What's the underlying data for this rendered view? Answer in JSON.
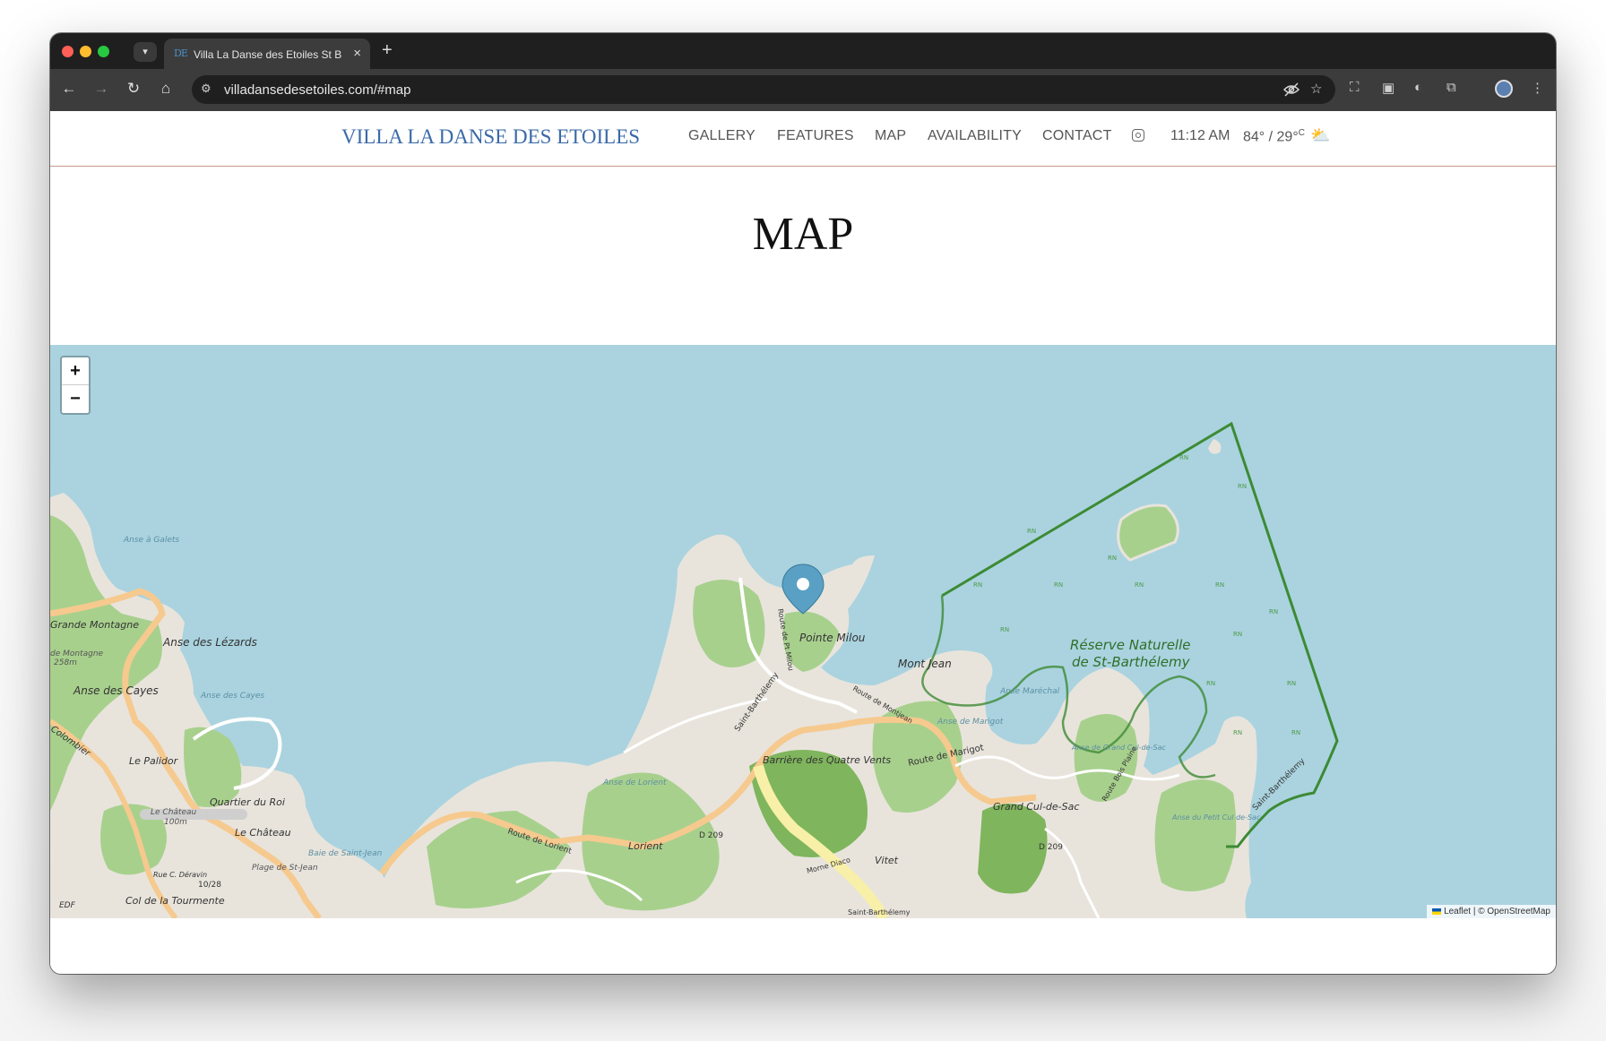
{
  "browser": {
    "tab": {
      "favicon": "DE",
      "title": "Villa La Danse des Etoiles St B",
      "close_glyph": "×"
    },
    "new_tab_glyph": "+",
    "url": "villadansedesetoiles.com/#map",
    "icons": [
      "chevron-down-icon",
      "back-icon",
      "forward-icon",
      "reload-icon",
      "home-icon",
      "site-info-icon",
      "eye-off-icon",
      "star-icon",
      "screen-icon",
      "camera-icon",
      "contrast-icon",
      "puzzle-icon",
      "avatar",
      "more-icon"
    ]
  },
  "site": {
    "brand": "VILLA LA DANSE DES ETOILES",
    "nav": {
      "gallery": "GALLERY",
      "features": "FEATURES",
      "map": "MAP",
      "availability": "AVAILABILITY",
      "contact": "CONTACT"
    },
    "weather": {
      "time": "11:12 AM",
      "temp": "84° / 29°",
      "temp_unit": "C"
    },
    "brand_color": "#3a6aa8",
    "divider_color": "#c49a8a"
  },
  "section": {
    "title": "MAP"
  },
  "map": {
    "zoom_in": "+",
    "zoom_out": "−",
    "attribution": {
      "leaflet": "Leaflet",
      "osm": "| © OpenStreetMap"
    },
    "labels": {
      "anse_galets": "Anse à Galets",
      "grande_montagne": "Grande Montagne",
      "anse_lezards": "Anse des Lézards",
      "de_montagne": "de Montagne",
      "m258": "258m",
      "anse_cayes": "Anse des Cayes",
      "anse_cayes_bay": "Anse des Cayes",
      "colombier": "Colombier",
      "le_palidor": "Le Palidor",
      "quartier_du_roi": "Quartier du Roi",
      "le_chateau_peak": "Le Château",
      "m100": "100m",
      "le_chateau": "Le Château",
      "baie_saint_jean": "Baie de Saint-Jean",
      "plage_saint_jean": "Plage de St-Jean",
      "rue_deravin": "Rue C. Déravin",
      "runway": "10/28",
      "col_tourmente": "Col de la Tourmente",
      "edf": "EDF",
      "pointe_milou": "Pointe Milou",
      "route_pt_milou": "Route de Pt Milou",
      "mont_jean": "Mont Jean",
      "route_montjean": "Route de Montjean",
      "saint_barthelemy_road": "Saint-Barthélemy",
      "anse_lorient": "Anse de Lorient",
      "barriere": "Barrière des Quatre Vents",
      "route_marigot": "Route de Marigot",
      "route_lorient": "Route de Lorient",
      "lorient": "Lorient",
      "d209": "D 209",
      "d209b": "D 209",
      "morne_diaco": "Morne Diaco",
      "vitet": "Vitet",
      "grand_cul_de_sac": "Grand Cul-de-Sac",
      "anse_marechal": "Anse Maréchal",
      "anse_marigot": "Anse de Marigot",
      "anse_grand_cul": "Anse de Grand Cul-de-Sac",
      "anse_petit_cul": "Anse du Petit Cul de-Sac",
      "reserve_line1": "Réserve Naturelle",
      "reserve_line2": "de St-Barthélemy",
      "saint_barthelemy_east": "Saint-Barthélemy",
      "route_bois_plaine": "Route Bois Plaine",
      "saint_barthelemy_south": "Saint-Barthélemy",
      "rn": "RN"
    },
    "colors": {
      "water": "#aad3df",
      "land": "#e8e4dc",
      "vegetation": "#a8d08d",
      "forest": "#7fb55c",
      "road_major": "#f6c98e",
      "reserve_border": "#3d8a34",
      "marker": "#5aa0c4"
    }
  }
}
